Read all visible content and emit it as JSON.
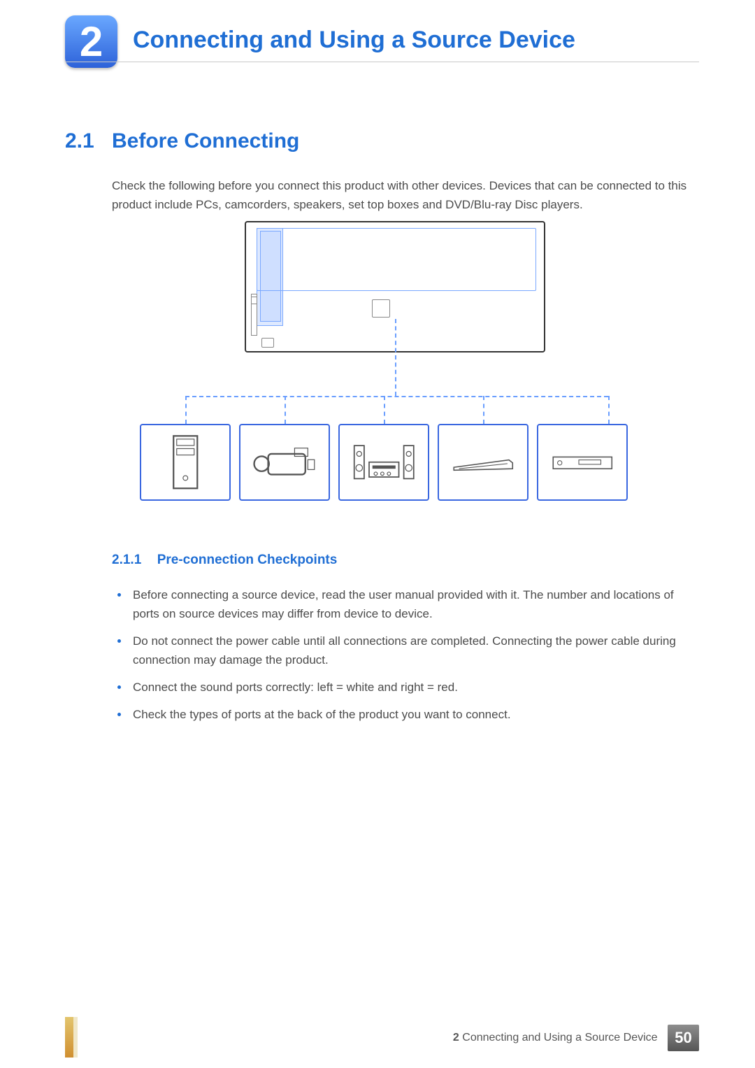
{
  "chapter": {
    "number": "2",
    "title": "Connecting and Using a Source Device"
  },
  "section": {
    "number": "2.1",
    "title": "Before Connecting",
    "intro": "Check the following before you connect this product with other devices. Devices that can be connected to this product include PCs, camcorders, speakers, set top boxes and DVD/Blu-ray Disc players."
  },
  "subsection": {
    "number": "2.1.1",
    "title": "Pre-connection Checkpoints",
    "bullets": [
      "Before connecting a source device, read the user manual provided with it. The number and locations of ports on source devices may differ from device to device.",
      "Do not connect the power cable until all connections are completed. Connecting the power cable during connection may damage the product.",
      "Connect the sound ports correctly: left = white and right = red.",
      "Check the types of ports at the back of the product you want to connect."
    ]
  },
  "diagram": {
    "devices": [
      "pc-tower",
      "camcorder",
      "speaker-system",
      "set-top-box",
      "dvd-player"
    ]
  },
  "footer": {
    "chapter_number": "2",
    "chapter_title": "Connecting and Using a Source Device",
    "page_number": "50"
  }
}
